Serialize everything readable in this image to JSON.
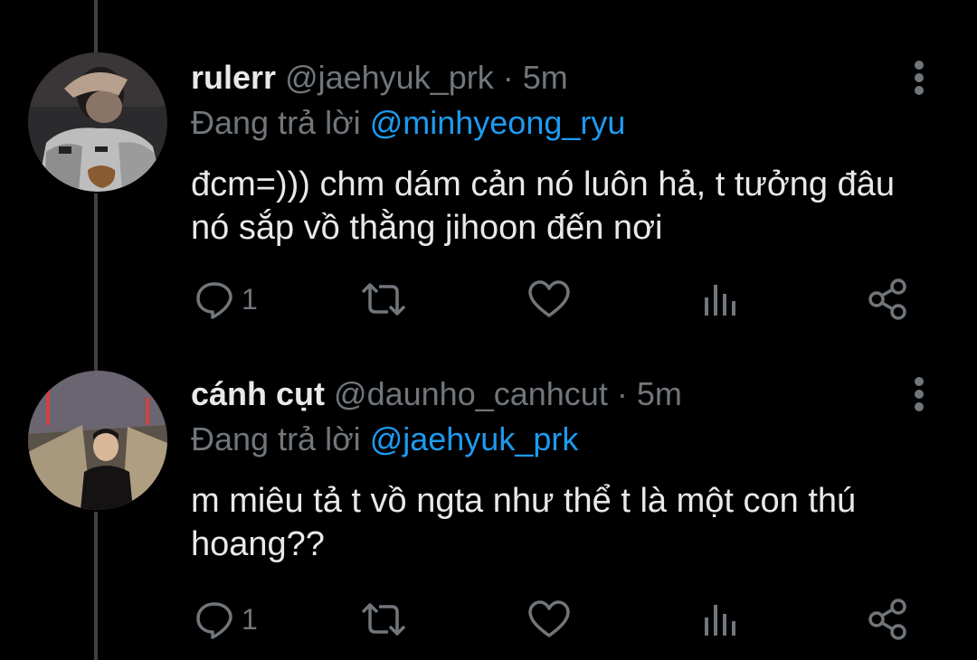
{
  "colors": {
    "background": "#000000",
    "text_primary": "#e7e9ea",
    "text_secondary": "#71767b",
    "mention": "#1d9bf0",
    "thread_line": "#3e4144"
  },
  "tweets": [
    {
      "display_name": "rulerr",
      "handle": "@jaehyuk_prk",
      "separator": "·",
      "time": "5m",
      "reply_prefix": "Đang trả lời",
      "reply_to": "@minhyeong_ryu",
      "text": "đcm=))) chm dám cản nó luôn hả, t tưởng đâu nó sắp vồ thằng jihoon đến nơi",
      "reply_count": "1",
      "icons": [
        "reply-icon",
        "retweet-icon",
        "like-icon",
        "analytics-icon",
        "share-icon",
        "more-icon"
      ]
    },
    {
      "display_name": "cánh cụt",
      "handle": "@daunho_canhcut",
      "separator": "·",
      "time": "5m",
      "reply_prefix": "Đang trả lời",
      "reply_to": "@jaehyuk_prk",
      "text": "m miêu tả t vồ ngta như thể t là một con thú hoang??",
      "reply_count": "1",
      "icons": [
        "reply-icon",
        "retweet-icon",
        "like-icon",
        "analytics-icon",
        "share-icon",
        "more-icon"
      ]
    }
  ]
}
